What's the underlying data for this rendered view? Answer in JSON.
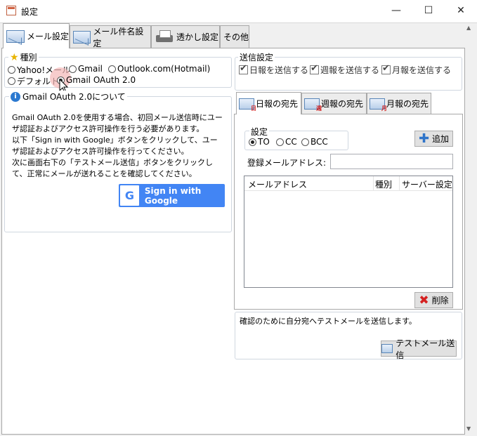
{
  "window": {
    "title": "設定"
  },
  "tabs": [
    {
      "label": "メール設定",
      "icon": "mail-icon",
      "active": true
    },
    {
      "label": "メール件名設定",
      "icon": "mail-icon",
      "active": false
    },
    {
      "label": "透かし設定",
      "icon": "printer-icon",
      "active": false
    },
    {
      "label": "その他",
      "active": false
    }
  ],
  "type_group": {
    "label": "種別",
    "options": [
      "Yahoo!メール",
      "Gmail",
      "Outlook.com(Hotmail)",
      "デフォルト",
      "Gmail OAuth 2.0"
    ],
    "selected": "Gmail OAuth 2.0"
  },
  "oauth_info": {
    "label": "Gmail OAuth 2.0について",
    "text": "Gmail OAuth 2.0を使用する場合、初回メール送信時にユーザ認証およびアクセス許可操作を行う必要があります。\n以下「Sign in with Google」ボタンをクリックして、ユーザ認証およびアクセス許可操作を行ってください。\n次に画面右下の「テストメール送信」ボタンをクリックして、正常にメールが送れることを確認してください。",
    "signin_label": "Sign in with Google"
  },
  "send_settings": {
    "label": "送信設定",
    "checks": [
      "日報を送信する",
      "週報を送信する",
      "月報を送信する"
    ]
  },
  "subtabs": [
    {
      "label": "日報の宛先",
      "badge": "日",
      "active": true
    },
    {
      "label": "週報の宛先",
      "badge": "週",
      "active": false
    },
    {
      "label": "月報の宛先",
      "badge": "月",
      "active": false
    }
  ],
  "recipient": {
    "setting_label": "設定",
    "modes": [
      "TO",
      "CC",
      "BCC"
    ],
    "selected_mode": "TO",
    "add_label": "追加",
    "address_label": "登録メールアドレス:",
    "address_value": "",
    "columns": [
      "メールアドレス",
      "種別",
      "サーバー設定"
    ],
    "rows": [],
    "delete_label": "削除"
  },
  "test_mail": {
    "description": "確認のために自分宛へテストメールを送信します。",
    "button_label": "テストメール送信"
  },
  "colors": {
    "accent": "#4285f4",
    "cursor_highlight": "#f4b6b6"
  }
}
